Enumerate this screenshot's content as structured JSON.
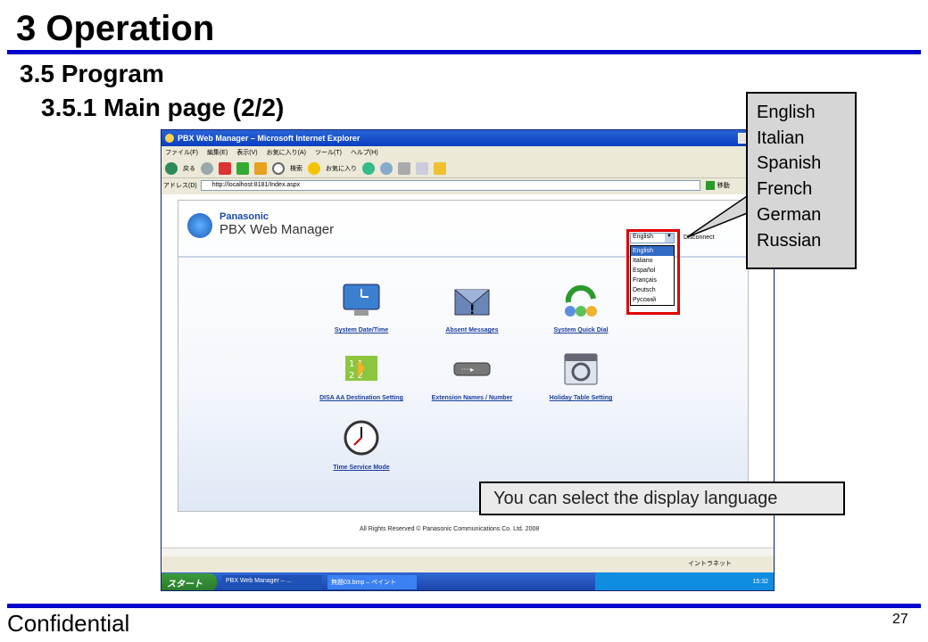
{
  "slide": {
    "title": "3 Operation",
    "section": "3.5 Program",
    "subsection": "3.5.1 Main page (2/2)",
    "footer_left": "Confidential",
    "page_number": "27",
    "rule_color": "#0000cc"
  },
  "language_callout": {
    "languages": [
      "English",
      "Italian",
      "Spanish",
      "French",
      "German",
      "Russian"
    ]
  },
  "note_callout": {
    "text": "You can select the display language"
  },
  "screenshot": {
    "window_title": "PBX Web Manager – Microsoft Internet Explorer",
    "menu": [
      "ファイル(F)",
      "編集(E)",
      "表示(V)",
      "お気に入り(A)",
      "ツール(T)",
      "ヘルプ(H)"
    ],
    "toolbar": {
      "back": "戻る",
      "search": "検索",
      "favorites": "お気に入り"
    },
    "address": {
      "label": "アドレス(D)",
      "url": "http://localhost:8181/Index.aspx",
      "go": "移動"
    },
    "page": {
      "brand": "Panasonic",
      "product": "PBX Web Manager",
      "language_select_value": "English",
      "language_options": [
        "English",
        "Italiano",
        "Español",
        "Français",
        "Deutsch",
        "Русский"
      ],
      "side_text": "Disconnect",
      "tiles": [
        {
          "label": "System Date/Time",
          "icon": "monitor-clock-icon"
        },
        {
          "label": "Absent Messages",
          "icon": "envelope-icon"
        },
        {
          "label": "System Quick Dial",
          "icon": "quick-dial-icon"
        },
        {
          "label": "DISA AA Destination Setting",
          "icon": "disa-aa-icon"
        },
        {
          "label": "Extension Names / Number",
          "icon": "extension-icon"
        },
        {
          "label": "Holiday Table Setting",
          "icon": "calendar-icon"
        },
        {
          "label": "Time Service Mode",
          "icon": "clock-icon"
        }
      ],
      "copyright": "All Rights Reserved © Panasonic Communications Co. Ltd. 2008"
    },
    "status": {
      "zone": "イントラネット"
    },
    "taskbar": {
      "start": "スタート",
      "tasks": [
        "PBX Web Manager – ...",
        "無題03.bmp – ペイント"
      ],
      "clock": "15:32"
    }
  }
}
